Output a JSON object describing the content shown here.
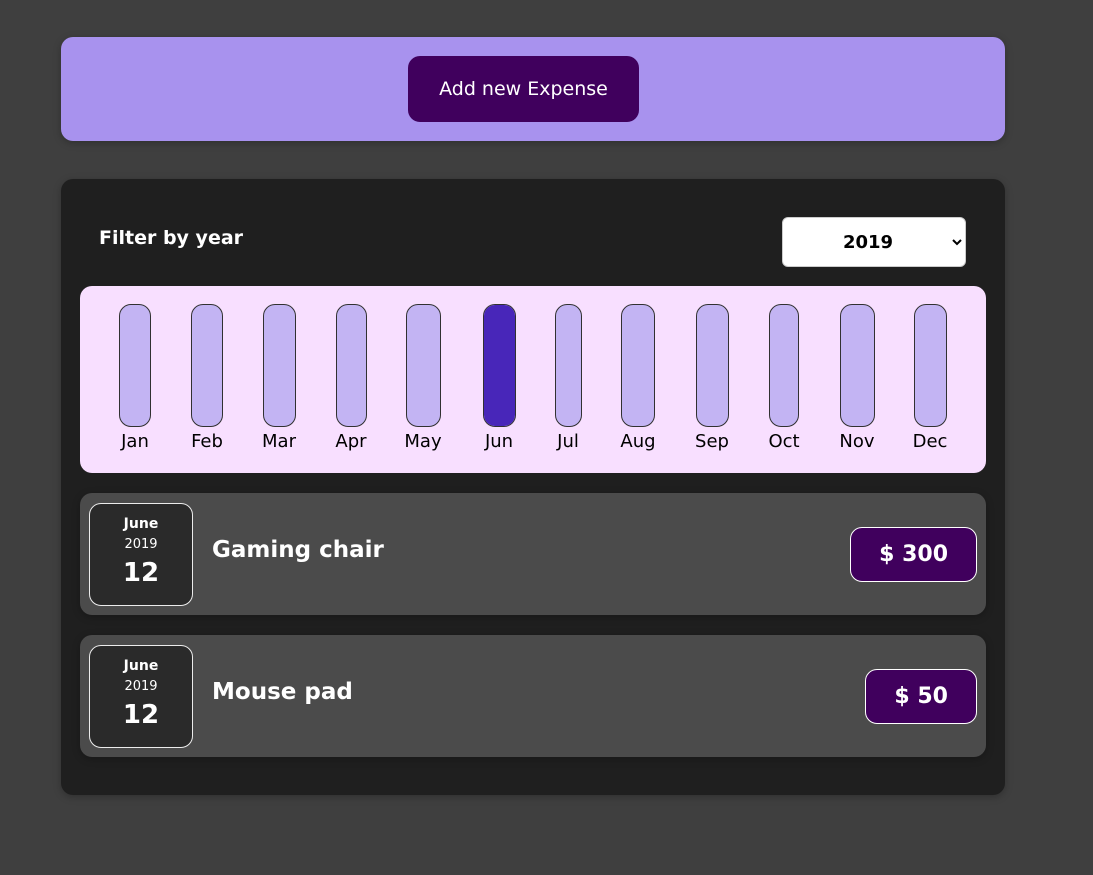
{
  "new_expense": {
    "add_button_label": "Add new Expense",
    "colors": {
      "panel": "#a892ee",
      "button": "#40005d"
    }
  },
  "filter": {
    "label": "Filter by year",
    "selected_year": "2019",
    "control_icon": "chevron-down-icon"
  },
  "chart": {
    "months": [
      {
        "label": "Jan",
        "fill": 0
      },
      {
        "label": "Feb",
        "fill": 0
      },
      {
        "label": "Mar",
        "fill": 0
      },
      {
        "label": "Apr",
        "fill": 0
      },
      {
        "label": "May",
        "fill": 0
      },
      {
        "label": "Jun",
        "fill": 1
      },
      {
        "label": "Jul",
        "fill": 0
      },
      {
        "label": "Aug",
        "fill": 0
      },
      {
        "label": "Sep",
        "fill": 0
      },
      {
        "label": "Oct",
        "fill": 0
      },
      {
        "label": "Nov",
        "fill": 0
      },
      {
        "label": "Dec",
        "fill": 0
      }
    ],
    "colors": {
      "background": "#f8dfff",
      "bar_empty": "#c3b4f3",
      "bar_fill": "#4826b9"
    }
  },
  "expenses": [
    {
      "month": "June",
      "year": "2019",
      "day": "12",
      "title": "Gaming chair",
      "amount": "$ 300"
    },
    {
      "month": "June",
      "year": "2019",
      "day": "12",
      "title": "Mouse pad",
      "amount": "$ 50"
    }
  ]
}
